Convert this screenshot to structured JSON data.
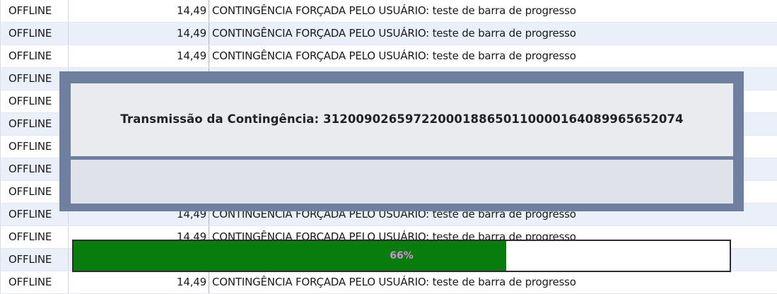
{
  "grid": {
    "rows": [
      {
        "status": "OFFLINE",
        "value": "14,49",
        "description": "CONTINGÊNCIA FORÇADA PELO USUÁRIO: teste de barra de progresso"
      },
      {
        "status": "OFFLINE",
        "value": "14,49",
        "description": "CONTINGÊNCIA FORÇADA PELO USUÁRIO: teste de barra de progresso"
      },
      {
        "status": "OFFLINE",
        "value": "14,49",
        "description": "CONTINGÊNCIA FORÇADA PELO USUÁRIO: teste de barra de progresso"
      },
      {
        "status": "OFFLINE",
        "value": "",
        "description": ""
      },
      {
        "status": "OFFLINE",
        "value": "",
        "description": ""
      },
      {
        "status": "OFFLINE",
        "value": "",
        "description": ""
      },
      {
        "status": "OFFLINE",
        "value": "",
        "description": ""
      },
      {
        "status": "OFFLINE",
        "value": "",
        "description": ""
      },
      {
        "status": "OFFLINE",
        "value": "",
        "description": ""
      },
      {
        "status": "OFFLINE",
        "value": "14,49",
        "description": "CONTINGÊNCIA FORÇADA PELO USUÁRIO: teste de barra de progresso"
      },
      {
        "status": "OFFLINE",
        "value": "14,49",
        "description": "CONTINGÊNCIA FORÇADA PELO USUÁRIO: teste de barra de progresso"
      },
      {
        "status": "OFFLINE",
        "value": "14,49",
        "description": "CONTINGÊNCIA FORÇADA PELO USUÁRIO: teste de barra de progresso"
      },
      {
        "status": "OFFLINE",
        "value": "14,49",
        "description": "CONTINGÊNCIA FORÇADA PELO USUÁRIO: teste de barra de progresso"
      }
    ]
  },
  "dialog": {
    "message": "Transmissão da Contingência: 31200902659722000188650110000164089965652074",
    "progress": {
      "percent": 66,
      "label": "66%"
    }
  },
  "colors": {
    "progress_fill": "#087c0c",
    "progress_label": "#d48fd8",
    "dialog_frame": "#6e7fa0",
    "row_alt": "#e9f0f9"
  }
}
